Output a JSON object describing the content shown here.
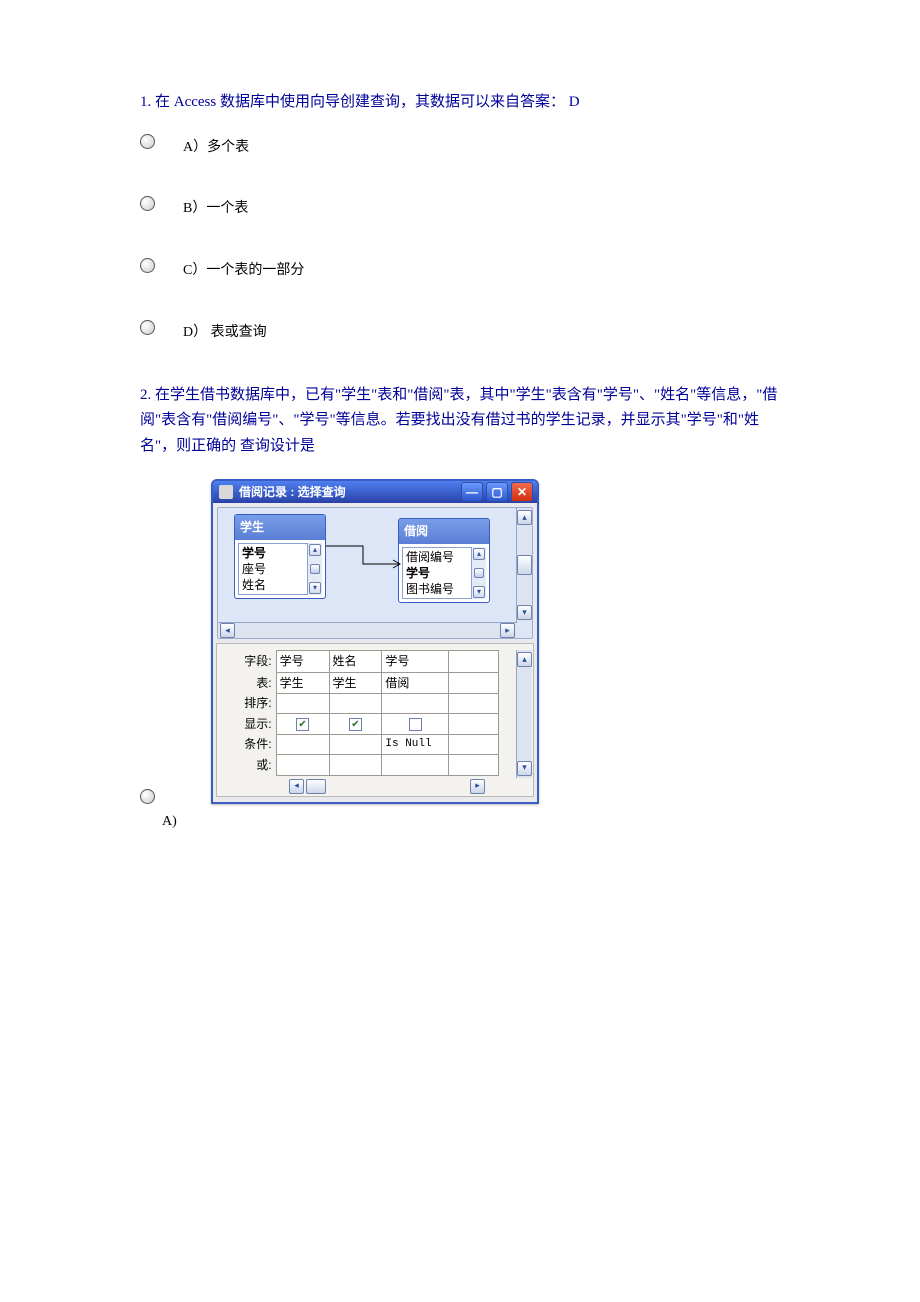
{
  "q1": {
    "text": "1. 在 Access 数据库中使用向导创建查询，其数据可以来自答案：  D",
    "options": {
      "a": "A）多个表",
      "b": "B）一个表",
      "c": "C）一个表的一部分",
      "d": "D） 表或查询"
    }
  },
  "q2": {
    "text": "2. 在学生借书数据库中，已有\"学生\"表和\"借阅\"表，其中\"学生\"表含有\"学号\"、\"姓名\"等信息，\"借阅\"表含有\"借阅编号\"、\"学号\"等信息。若要找出没有借过书的学生记录，并显示其\"学号\"和\"姓名\"，则正确的   查询设计是",
    "option_a_label": "A)"
  },
  "access": {
    "title": "借阅记录  :  选择查询",
    "table1": {
      "title": "学生",
      "f1": "学号",
      "f2": "座号",
      "f3": "姓名"
    },
    "table2": {
      "title": "借阅",
      "f1": "借阅编号",
      "f2": "学号",
      "f3": "图书编号"
    },
    "grid": {
      "row_labels": {
        "field": "字段:",
        "table": "表:",
        "sort": "排序:",
        "show": "显示:",
        "cond": "条件:",
        "or": "或:"
      },
      "cols": {
        "c1": {
          "field": "学号",
          "table": "学生",
          "show": true
        },
        "c2": {
          "field": "姓名",
          "table": "学生",
          "show": true
        },
        "c3": {
          "field": "学号",
          "table": "借阅",
          "show": false,
          "cond": "Is Null"
        }
      }
    }
  }
}
